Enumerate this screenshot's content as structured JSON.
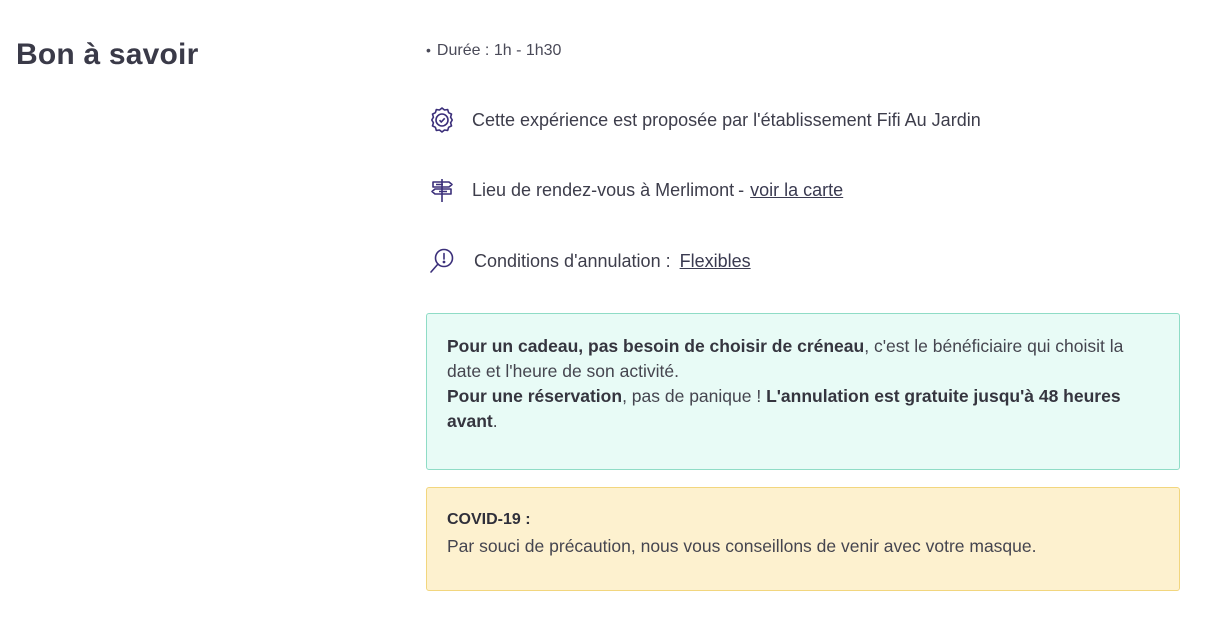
{
  "section": {
    "title": "Bon à savoir"
  },
  "details": {
    "duration": "Durée : 1h - 1h30",
    "provider": {
      "icon": "badge-icon",
      "text": "Cette expérience est proposée par l'établissement Fifi Au Jardin"
    },
    "location": {
      "icon": "signpost-icon",
      "text": "Lieu de rendez-vous à Merlimont",
      "separator": "-",
      "link_label": "voir la carte"
    },
    "cancellation": {
      "icon": "magnifier-alert-icon",
      "text": "Conditions d'annulation",
      "separator": ":",
      "link_label": "Flexibles"
    }
  },
  "gift_notice": {
    "bold1": "Pour un cadeau, pas besoin de choisir de créneau",
    "text1": ", c'est le bénéficiaire qui choisit la date et l'heure de son activité.",
    "bold2": "Pour une réservation",
    "text2": ", pas de panique ! ",
    "bold3": "L'annulation est gratuite jusqu'à 48 heures avant",
    "text3": "."
  },
  "covid_notice": {
    "title": "COVID-19 :",
    "text": "Par souci de précaution, nous vous conseillons de venir avec votre masque."
  },
  "colors": {
    "gift_bg": "#e8fbf6",
    "gift_border": "#8fdcc6",
    "covid_bg": "#fdf1cf",
    "covid_border": "#f2d67e",
    "icon": "#3b2f7a"
  }
}
